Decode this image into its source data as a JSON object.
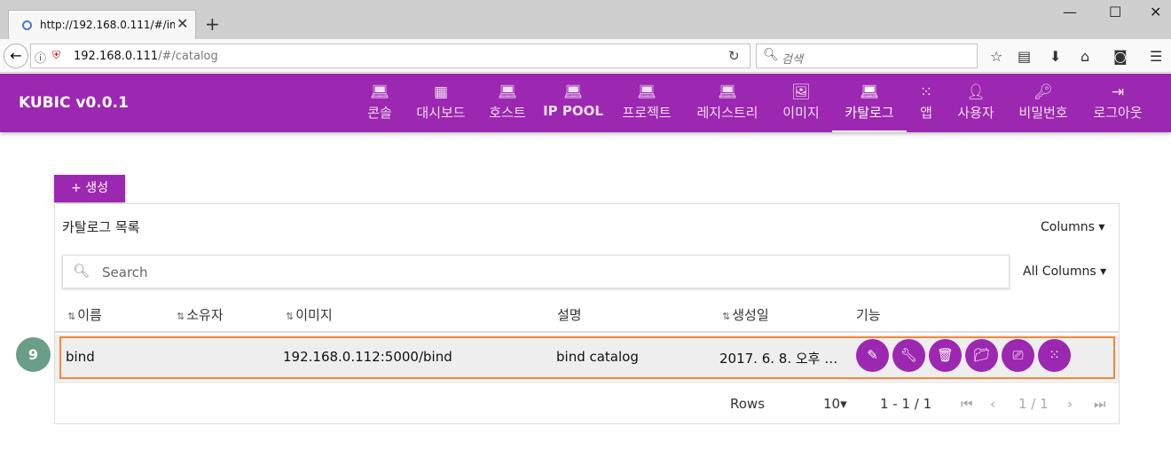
{
  "browser": {
    "tab_title": "http://192.168.0.111/#/imag",
    "tab_close": "✕",
    "new_tab": "+",
    "window_controls": {
      "minimize": "—",
      "maximize": "☐",
      "close": "✕"
    },
    "url_host": "192.168.0.111",
    "url_path": "/#/catalog",
    "search_placeholder": "검색",
    "icons": [
      "back-arrow-icon",
      "info-icon",
      "shield-icon",
      "reload-icon",
      "search-icon",
      "star-icon",
      "reading-list-icon",
      "download-icon",
      "home-icon",
      "pocket-icon",
      "hamburger-menu-icon"
    ]
  },
  "app": {
    "brand": "KUBIC v0.0.1",
    "accent_color": "#9c27b0",
    "menu": [
      {
        "label": "콘솔",
        "icon": "laptop-icon"
      },
      {
        "label": "대시보드",
        "icon": "dashboard-icon"
      },
      {
        "label": "호스트",
        "icon": "laptop-icon"
      },
      {
        "label": "IP POOL",
        "icon": "laptop-icon"
      },
      {
        "label": "프로젝트",
        "icon": "laptop-icon"
      },
      {
        "label": "레지스트리",
        "icon": "laptop-icon"
      },
      {
        "label": "이미지",
        "icon": "image-icon"
      },
      {
        "label": "카탈로그",
        "icon": "laptop-icon",
        "active": true
      },
      {
        "label": "앱",
        "icon": "apps-grid-icon"
      },
      {
        "label": "사용자",
        "icon": "person-icon"
      },
      {
        "label": "비밀번호",
        "icon": "key-icon"
      },
      {
        "label": "로그아웃",
        "icon": "logout-icon"
      }
    ]
  },
  "page": {
    "create_label": "+ 생성",
    "panel_title": "카탈로그 목록",
    "columns_dropdown": "Columns",
    "search_placeholder": "Search",
    "all_columns_dropdown": "All Columns",
    "headers": [
      "이름",
      "소유자",
      "이미지",
      "설명",
      "생성일",
      "기능"
    ],
    "rows": [
      {
        "name": "bind",
        "owner": "",
        "image": "192.168.0.112:5000/bind",
        "description": "bind catalog",
        "created": "2017. 6. 8. 오후 …",
        "actions": [
          "edit-icon",
          "wrench-icon",
          "delete-icon",
          "folder-icon",
          "cast-icon",
          "apps-grid-icon"
        ]
      }
    ],
    "pagination": {
      "rows_label": "Rows",
      "rows_per_page": "10",
      "range": "1 - 1 / 1",
      "page": "1 / 1"
    },
    "step_badge": "9"
  }
}
